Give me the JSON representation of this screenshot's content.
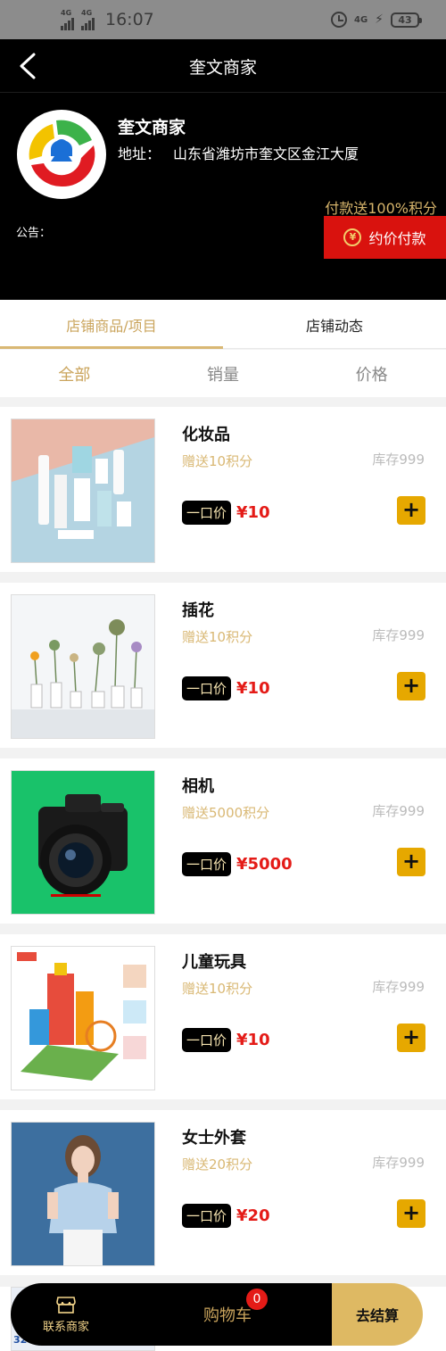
{
  "status_bar": {
    "signal1": "4G",
    "signal2": "4G",
    "time": "16:07",
    "net": "4G",
    "battery": "43"
  },
  "navbar": {
    "title": "奎文商家"
  },
  "store": {
    "name": "奎文商家",
    "address_label": "地址：",
    "address_value": "山东省潍坊市奎文区金江大厦",
    "promo_text": "付款送100%积分",
    "pay_button_label": "约价付款",
    "pay_icon": "¥",
    "notice_label": "公告："
  },
  "tabs": [
    {
      "label": "店铺商品/项目",
      "active": true
    },
    {
      "label": "店铺动态",
      "active": false
    }
  ],
  "sort": [
    {
      "label": "全部",
      "active": true
    },
    {
      "label": "销量",
      "active": false
    },
    {
      "label": "价格",
      "active": false
    }
  ],
  "products": [
    {
      "name": "化妆品",
      "bonus": "赠送10积分",
      "stock": "库存999",
      "price_tag": "一口价",
      "price": "¥10",
      "image": "cosmetics"
    },
    {
      "name": "插花",
      "bonus": "赠送10积分",
      "stock": "库存999",
      "price_tag": "一口价",
      "price": "¥10",
      "image": "flowers"
    },
    {
      "name": "相机",
      "bonus": "赠送5000积分",
      "stock": "库存999",
      "price_tag": "一口价",
      "price": "¥5000",
      "image": "camera"
    },
    {
      "name": "儿童玩具",
      "bonus": "赠送10积分",
      "stock": "库存999",
      "price_tag": "一口价",
      "price": "¥10",
      "image": "toys"
    },
    {
      "name": "女士外套",
      "bonus": "赠送20积分",
      "stock": "库存999",
      "price_tag": "一口价",
      "price": "¥20",
      "image": "coat"
    }
  ],
  "add_symbol": "+",
  "peek_text": "320g 2袋",
  "bottom_bar": {
    "contact_label": "联系商家",
    "cart_label": "购物车",
    "cart_count": "0",
    "checkout_label": "去结算"
  },
  "colors": {
    "accent_gold": "#caa45c",
    "price_red": "#e41b17",
    "pay_red": "#d9120e",
    "add_yellow": "#e6a800"
  }
}
